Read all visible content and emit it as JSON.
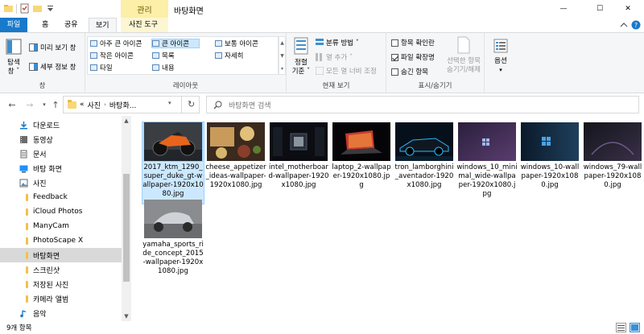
{
  "window": {
    "title": "바탕화면",
    "context_tab_label": "관리",
    "controls": {
      "minimize": "—",
      "maximize": "☐",
      "close": "✕"
    }
  },
  "tabs": [
    {
      "label": "파일"
    },
    {
      "label": "홈"
    },
    {
      "label": "공유"
    },
    {
      "label": "보기"
    },
    {
      "label": "사진 도구"
    }
  ],
  "ribbon": {
    "pane_group": {
      "label": "창",
      "nav_pane": "탐색\n창 ˇ",
      "preview_pane": "미리 보기 창",
      "details_pane": "세부 정보 창"
    },
    "layout_group": {
      "label": "레이아웃",
      "items": [
        "아주 큰 아이콘",
        "큰 아이콘",
        "보통 아이콘",
        "작은 아이콘",
        "목록",
        "자세히",
        "타일",
        "내용"
      ],
      "selected": "큰 아이콘"
    },
    "current_view_group": {
      "label": "현재 보기",
      "sort": "정렬\n기준 ˇ",
      "group_by": "분류 방법 ˇ",
      "add_columns": "열 추가 ˇ",
      "fit_columns": "모든 열 너비 조정"
    },
    "show_hide_group": {
      "label": "표시/숨기기",
      "item_checkboxes": "항목 확인란",
      "item_checkboxes_checked": false,
      "file_extensions": "파일 확장명",
      "file_extensions_checked": true,
      "hidden_items": "숨긴 항목",
      "hidden_items_checked": false,
      "hide_selected": "선택한 항목\n숨기기/해제"
    },
    "options": "옵션"
  },
  "address": {
    "path_prefix": "«",
    "path": [
      "사진",
      "바탕화..."
    ],
    "search_placeholder": "바탕화면 검색"
  },
  "nav_items": [
    {
      "label": "다운로드",
      "icon": "download-icon"
    },
    {
      "label": "동영상",
      "icon": "video-icon"
    },
    {
      "label": "문서",
      "icon": "document-icon"
    },
    {
      "label": "바탕 화면",
      "icon": "desktop-icon"
    },
    {
      "label": "사진",
      "icon": "pictures-icon"
    },
    {
      "label": "Feedback",
      "icon": "folder-icon"
    },
    {
      "label": "iCloud Photos",
      "icon": "folder-icon"
    },
    {
      "label": "ManyCam",
      "icon": "folder-icon"
    },
    {
      "label": "PhotoScape X",
      "icon": "folder-icon"
    },
    {
      "label": "바탕화면",
      "icon": "folder-icon",
      "selected": true
    },
    {
      "label": "스크린샷",
      "icon": "folder-icon"
    },
    {
      "label": "저장된 사진",
      "icon": "folder-icon"
    },
    {
      "label": "카메라 앨범",
      "icon": "folder-icon"
    },
    {
      "label": "음악",
      "icon": "music-icon"
    }
  ],
  "files": [
    {
      "name": "2017_ktm_1290_super_duke_gt-wallpaper-1920x1080.jpg",
      "selected": true
    },
    {
      "name": "cheese_appetizer_ideas-wallpaper-1920x1080.jpg"
    },
    {
      "name": "intel_motherboard-wallpaper-1920x1080.jpg"
    },
    {
      "name": "laptop_2-wallpaper-1920x1080.jpg"
    },
    {
      "name": "tron_lamborghini_aventador-1920x1080.jpg"
    },
    {
      "name": "windows_10_minimal_wide-wallpaper-1920x1080.jpg"
    },
    {
      "name": "windows_10-wallpaper-1920x1080.jpg"
    },
    {
      "name": "windows_79-wallpaper-1920x1080.jpg"
    },
    {
      "name": "yamaha_sports_ride_concept_2015-wallpaper-1920x1080.jpg"
    }
  ],
  "status": {
    "item_count": "9개 항목"
  }
}
